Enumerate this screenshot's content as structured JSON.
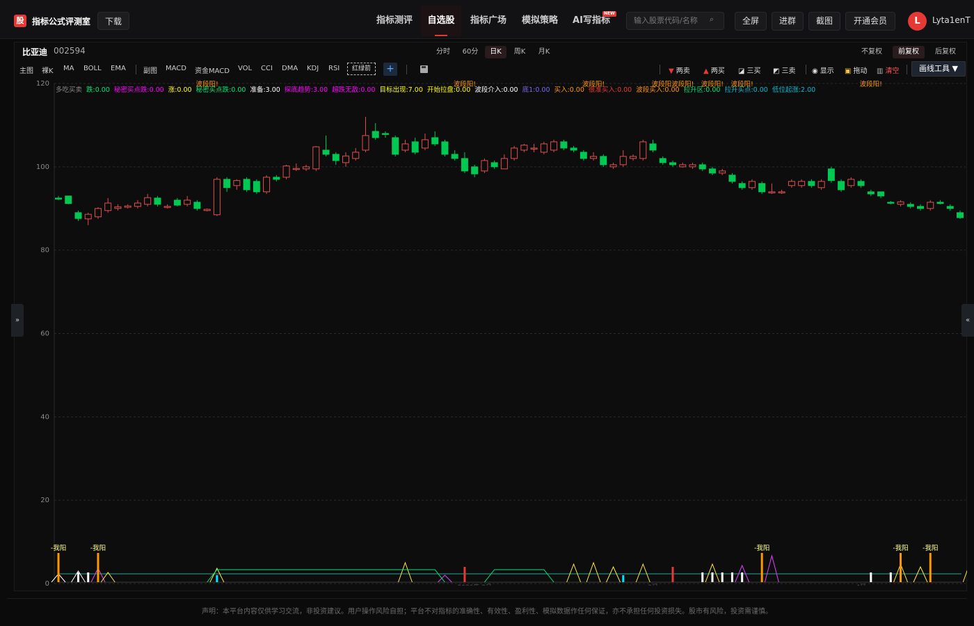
{
  "app": {
    "brand": "指标公式评测室",
    "logo_glyph": "股",
    "download": "下载"
  },
  "nav": [
    {
      "label": "指标测评",
      "active": false
    },
    {
      "label": "自选股",
      "active": true
    },
    {
      "label": "指标广场",
      "active": false
    },
    {
      "label": "模拟策略",
      "active": false
    },
    {
      "label": "AI写指标",
      "active": false,
      "badge": "NEW"
    }
  ],
  "search": {
    "placeholder": "输入股票代码/名称"
  },
  "toolbar_buttons": [
    "全屏",
    "进群",
    "截图",
    "开通会员"
  ],
  "user": {
    "avatar_letter": "L",
    "name": "Lyta1enT"
  },
  "stock": {
    "name": "比亚迪",
    "code": "002594"
  },
  "periods": [
    {
      "label": "分时",
      "active": false
    },
    {
      "label": "60分",
      "active": false
    },
    {
      "label": "日K",
      "active": true
    },
    {
      "label": "周K",
      "active": false
    },
    {
      "label": "月K",
      "active": false
    }
  ],
  "adjust": [
    {
      "label": "不复权",
      "active": false
    },
    {
      "label": "前复权",
      "active": true
    },
    {
      "label": "后复权",
      "active": false
    }
  ],
  "indicators_main": [
    "主图",
    "裸K",
    "MA",
    "BOLL",
    "EMA"
  ],
  "indicators_sub": [
    "副图",
    "MACD",
    "资金MACD",
    "VOL",
    "CCI",
    "DMA",
    "KDJ",
    "RSI"
  ],
  "indicator_custom": "红绿箭",
  "draw_tools": [
    {
      "label": "两卖",
      "icon": "down-triangle-icon",
      "color": "#e53935"
    },
    {
      "label": "两买",
      "icon": "up-triangle-icon",
      "color": "#e53935"
    },
    {
      "label": "三买",
      "icon": "line-icon",
      "color": "#ddd"
    },
    {
      "label": "三卖",
      "icon": "line-icon",
      "color": "#ddd"
    }
  ],
  "view_tools": [
    {
      "label": "显示",
      "icon": "eye-icon"
    },
    {
      "label": "拖动",
      "icon": "lock-icon"
    },
    {
      "label": "清空",
      "icon": "trash-icon"
    }
  ],
  "draw_tool_menu": "画线工具 ▼",
  "legend": [
    {
      "text": "多吃买卖",
      "color": "#888888"
    },
    {
      "text": "跌:0.00",
      "color": "#00e676"
    },
    {
      "text": "秘密买点跌:0.00",
      "color": "#ff00ff"
    },
    {
      "text": "涨:0.00",
      "color": "#ffff00"
    },
    {
      "text": "秘密买点跌:0.00",
      "color": "#00e676"
    },
    {
      "text": "准备:3.00",
      "color": "#ffffff"
    },
    {
      "text": "探底趋势:3.00",
      "color": "#ff00ff"
    },
    {
      "text": "超跌无敌:0.00",
      "color": "#ff00ff"
    },
    {
      "text": "目标出现:7.00",
      "color": "#ffff00"
    },
    {
      "text": "开始拉盘:0.00",
      "color": "#ffff00"
    },
    {
      "text": "波段介入:0.00",
      "color": "#ffffff"
    },
    {
      "text": "底1:0.00",
      "color": "#7b68ee"
    },
    {
      "text": "买入:0.00",
      "color": "#ff9800"
    },
    {
      "text": "很准买入:0.00",
      "color": "#e53935"
    },
    {
      "text": "波段买入:0.00",
      "color": "#ff9800"
    },
    {
      "text": "拉升区:0.00",
      "color": "#00e676"
    },
    {
      "text": "拉升买点:0.00",
      "color": "#00bcd4"
    },
    {
      "text": "低位起涨:2.00",
      "color": "#00bcd4"
    }
  ],
  "chart_data": {
    "type": "candlestick",
    "y_axis": {
      "min": 0,
      "max": 120,
      "ticks": [
        0,
        20,
        40,
        60,
        80,
        100,
        120
      ]
    },
    "x_labels": [
      "2026年 2月",
      "3月",
      "4月"
    ],
    "up_color": "#e04f4f",
    "down_color": "#00c853",
    "candles": [
      [
        92.5,
        92.3,
        93.0,
        92.0
      ],
      [
        93.0,
        91.2,
        93.0,
        91.0
      ],
      [
        89.0,
        87.6,
        89.5,
        87.0
      ],
      [
        87.5,
        88.6,
        89.0,
        86.0
      ],
      [
        88.0,
        90.0,
        90.3,
        87.5
      ],
      [
        89.5,
        91.3,
        92.5,
        89.0
      ],
      [
        90.0,
        90.4,
        91.0,
        89.5
      ],
      [
        90.3,
        90.6,
        91.0,
        90.0
      ],
      [
        90.5,
        91.3,
        92.0,
        90.0
      ],
      [
        91.0,
        92.6,
        93.5,
        90.5
      ],
      [
        92.5,
        91.0,
        93.0,
        90.5
      ],
      [
        90.3,
        90.5,
        91.0,
        90.0
      ],
      [
        92.0,
        90.8,
        92.5,
        90.5
      ],
      [
        91.0,
        92.0,
        93.0,
        90.5
      ],
      [
        91.5,
        90.0,
        92.0,
        89.5
      ],
      [
        89.5,
        89.8,
        90.0,
        89.3
      ],
      [
        88.5,
        97.0,
        97.5,
        88.2
      ],
      [
        97.0,
        95.0,
        97.5,
        94.0
      ],
      [
        95.5,
        96.7,
        97.0,
        94.5
      ],
      [
        97.0,
        94.5,
        97.5,
        94.0
      ],
      [
        96.5,
        94.0,
        97.0,
        93.5
      ],
      [
        94.0,
        97.5,
        98.0,
        93.5
      ],
      [
        97.5,
        97.0,
        98.0,
        96.5
      ],
      [
        97.5,
        100.2,
        100.5,
        97.0
      ],
      [
        99.5,
        99.6,
        100.8,
        99.0
      ],
      [
        99.5,
        100.0,
        100.5,
        99.0
      ],
      [
        99.5,
        104.8,
        105.0,
        99.0
      ],
      [
        104.0,
        103.0,
        107.5,
        102.5
      ],
      [
        103.0,
        101.5,
        103.5,
        100.5
      ],
      [
        101.0,
        102.6,
        103.5,
        100.0
      ],
      [
        102.0,
        103.5,
        104.5,
        101.5
      ],
      [
        104.0,
        107.5,
        112.0,
        103.5
      ],
      [
        108.5,
        107.0,
        110.5,
        106.5
      ],
      [
        108.0,
        107.8,
        108.5,
        107.0
      ],
      [
        107.0,
        103.0,
        107.5,
        102.5
      ],
      [
        104.0,
        105.5,
        106.5,
        103.5
      ],
      [
        106.0,
        103.5,
        107.0,
        103.0
      ],
      [
        104.5,
        106.5,
        108.0,
        104.0
      ],
      [
        107.0,
        105.5,
        108.5,
        105.0
      ],
      [
        106.0,
        103.0,
        106.5,
        102.5
      ],
      [
        103.0,
        102.0,
        104.0,
        101.5
      ],
      [
        102.0,
        99.0,
        103.5,
        98.5
      ],
      [
        100.0,
        98.3,
        100.5,
        97.5
      ],
      [
        99.0,
        101.5,
        102.0,
        98.5
      ],
      [
        101.0,
        100.0,
        101.5,
        99.5
      ],
      [
        99.5,
        102.0,
        103.0,
        99.5
      ],
      [
        102.0,
        104.5,
        105.0,
        101.5
      ],
      [
        104.0,
        105.2,
        105.5,
        103.5
      ],
      [
        104.5,
        104.5,
        105.5,
        103.5
      ],
      [
        103.5,
        105.5,
        106.0,
        103.0
      ],
      [
        104.0,
        106.0,
        106.5,
        103.5
      ],
      [
        106.0,
        104.5,
        106.5,
        104.0
      ],
      [
        104.5,
        104.0,
        105.0,
        103.5
      ],
      [
        103.5,
        102.0,
        104.0,
        101.5
      ],
      [
        102.0,
        102.5,
        103.5,
        101.5
      ],
      [
        102.5,
        100.5,
        103.0,
        100.0
      ],
      [
        100.0,
        100.5,
        101.0,
        99.5
      ],
      [
        100.5,
        102.5,
        104.0,
        100.0
      ],
      [
        102.0,
        102.5,
        103.0,
        101.5
      ],
      [
        102.0,
        106.0,
        106.5,
        101.5
      ],
      [
        105.5,
        104.0,
        106.5,
        103.5
      ],
      [
        102.0,
        101.0,
        102.5,
        100.5
      ],
      [
        101.0,
        100.5,
        101.5,
        100.0
      ],
      [
        100.0,
        100.5,
        101.0,
        99.8
      ],
      [
        100.0,
        100.5,
        101.0,
        99.5
      ],
      [
        100.5,
        99.5,
        101.0,
        99.0
      ],
      [
        99.5,
        98.5,
        100.0,
        98.0
      ],
      [
        98.5,
        99.0,
        99.5,
        98.0
      ],
      [
        98.0,
        96.5,
        98.5,
        96.0
      ],
      [
        96.0,
        95.0,
        96.5,
        94.5
      ],
      [
        95.0,
        96.5,
        97.0,
        94.5
      ],
      [
        96.0,
        94.0,
        96.5,
        93.5
      ],
      [
        94.0,
        94.0,
        96.0,
        93.5
      ],
      [
        94.0,
        94.0,
        94.5,
        93.5
      ],
      [
        95.5,
        96.5,
        97.0,
        95.0
      ],
      [
        95.5,
        96.5,
        97.0,
        95.0
      ],
      [
        96.5,
        95.5,
        97.0,
        95.0
      ],
      [
        95.0,
        96.5,
        97.0,
        94.5
      ],
      [
        99.5,
        96.7,
        100.0,
        96.2
      ],
      [
        96.5,
        94.5,
        97.0,
        94.0
      ],
      [
        95.5,
        97.0,
        97.5,
        95.0
      ],
      [
        96.5,
        95.5,
        97.0,
        95.0
      ],
      [
        94.0,
        93.5,
        94.5,
        93.0
      ],
      [
        94.0,
        93.0,
        94.0,
        92.5
      ],
      [
        91.5,
        91.4,
        91.8,
        91.0
      ],
      [
        91.0,
        91.6,
        92.0,
        90.5
      ],
      [
        91.0,
        90.5,
        91.5,
        90.0
      ],
      [
        90.5,
        90.0,
        91.0,
        89.5
      ],
      [
        90.0,
        91.5,
        92.0,
        89.5
      ],
      [
        91.5,
        91.2,
        92.0,
        91.0
      ],
      [
        90.5,
        90.0,
        91.0,
        89.5
      ],
      [
        89.0,
        87.8,
        89.5,
        87.5
      ]
    ],
    "annotations": [
      {
        "text": "波段阳!",
        "color": "#ff9800",
        "candle": 15
      },
      {
        "text": "波段阳!",
        "color": "#ff9800",
        "candle": 41
      },
      {
        "text": "波段阳!",
        "color": "#ff9800",
        "candle": 54
      },
      {
        "text": "波段阳波段阳!",
        "color": "#ff9800",
        "candle": 62
      },
      {
        "text": "波段阳!",
        "color": "#ff9800",
        "candle": 66
      },
      {
        "text": "波段阳!",
        "color": "#ff9800",
        "candle": 69
      },
      {
        "text": "波段阳!",
        "color": "#ff9800",
        "candle": 82
      }
    ],
    "bottom_labels": [
      {
        "text": "-我阳",
        "color": "#ffff8d",
        "candle": 0
      },
      {
        "text": "-我阳",
        "color": "#ffff8d",
        "candle": 4
      },
      {
        "text": "-我阳",
        "color": "#ffff8d",
        "candle": 71
      },
      {
        "text": "-我阳",
        "color": "#ffff8d",
        "candle": 85
      },
      {
        "text": "-我阳",
        "color": "#ffff8d",
        "candle": 88
      }
    ]
  },
  "disclaimer": "声明：本平台内容仅供学习交流，非投资建议。用户操作风险自担；平台不对指标的准确性、有效性、盈利性、模拟数据作任何保证，亦不承担任何投资损失。股市有风险，投资需谨慎。"
}
